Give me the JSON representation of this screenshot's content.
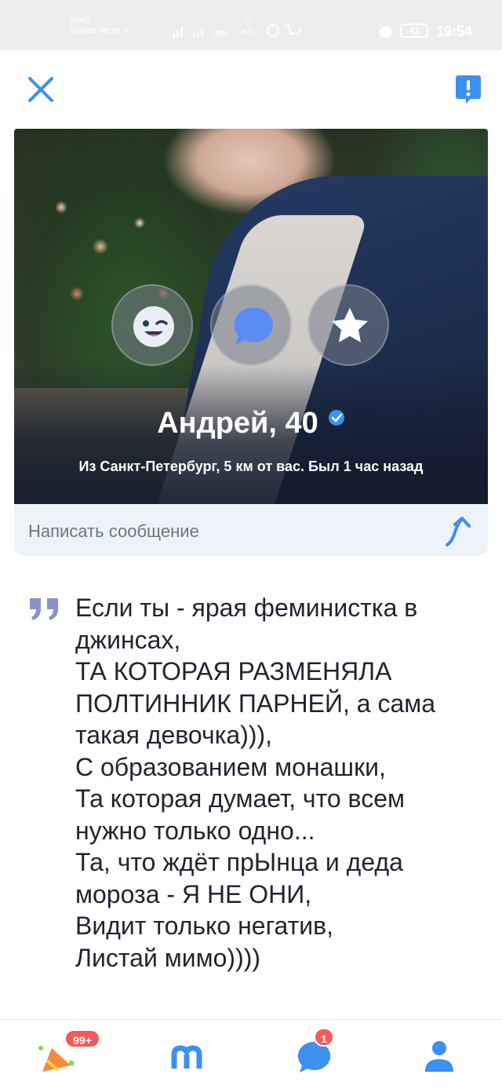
{
  "status_bar": {
    "carrier": "Tele2",
    "carrier_sub": "Только экстр. в...",
    "speed_value": "0",
    "speed_unit": "K/s",
    "battery": "42",
    "time": "19:54"
  },
  "top_bar": {
    "close_icon": "close-icon",
    "report_icon": "report-icon"
  },
  "profile": {
    "name": "Андрей, 40",
    "subtitle": "Из Санкт-Петербург, 5 км от вас. Был 1 час назад",
    "verified": true,
    "actions": [
      "wink-icon",
      "chat-bubble-icon",
      "star-icon"
    ]
  },
  "message": {
    "placeholder": "Написать сообщение"
  },
  "about": {
    "text": "Если ты - ярая феминистка в джинсах,\nТА КОТОРАЯ РАЗМЕНЯЛА ПОЛТИННИК ПАРНЕЙ, а сама такая девочка))),\nС образованием монашки,\nТа которая думает, что всем нужно только одно...\nТа, что ждёт прЫнца и деда мороза - Я НЕ ОНИ,\nВидит только негатив,\nЛистай мимо))))"
  },
  "bottom_nav": {
    "events_badge": "99+",
    "chats_badge": "1",
    "items": [
      "events-icon",
      "meetings-icon",
      "chats-icon",
      "profile-icon"
    ]
  },
  "colors": {
    "accent": "#3d8ff0",
    "badge": "#f35a5a",
    "quote": "#8b90c8"
  }
}
